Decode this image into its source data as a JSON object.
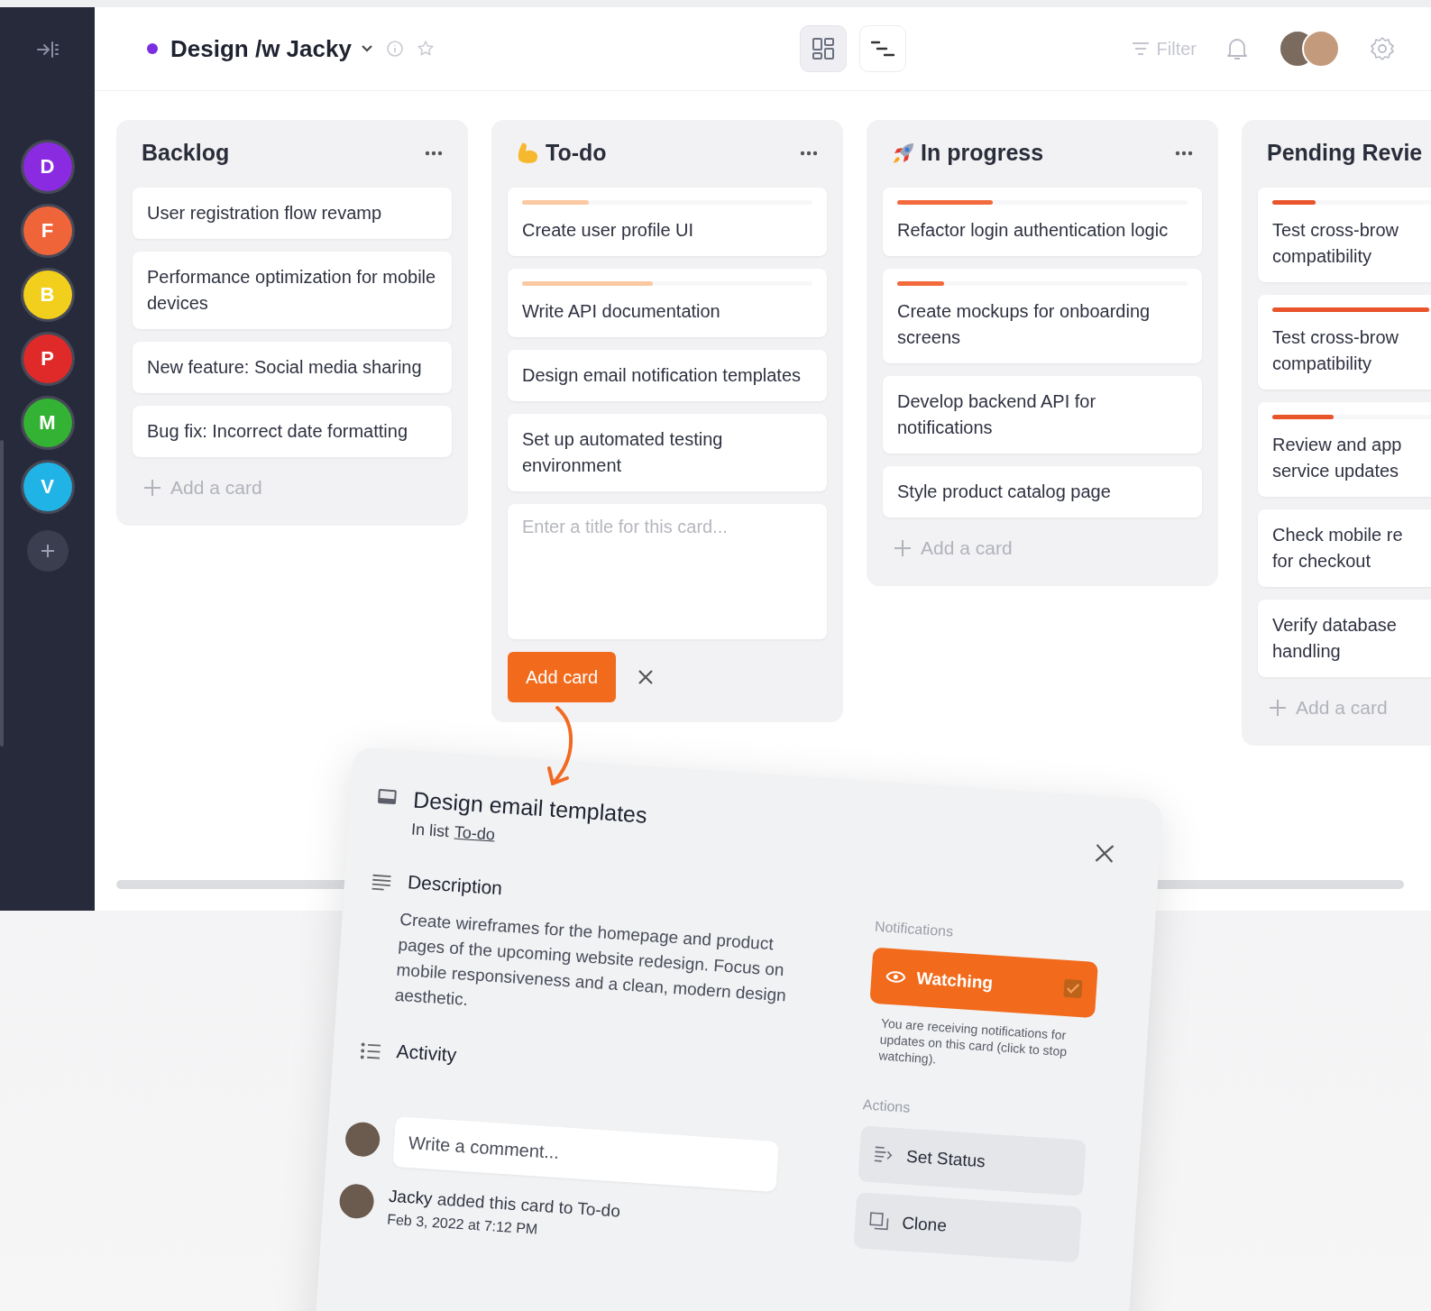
{
  "sidebar": {
    "workspaces": [
      {
        "initial": "D",
        "color": "#8a2be2"
      },
      {
        "initial": "F",
        "color": "#f0643a"
      },
      {
        "initial": "B",
        "color": "#f2cf1d"
      },
      {
        "initial": "P",
        "color": "#e02a2a"
      },
      {
        "initial": "M",
        "color": "#34b233"
      },
      {
        "initial": "V",
        "color": "#1fb3e6"
      }
    ]
  },
  "header": {
    "board_title": "Design /w Jacky",
    "views": [
      {
        "kind": "board",
        "selected": true
      },
      {
        "kind": "timeline",
        "selected": false
      }
    ],
    "filter": "Filter"
  },
  "columns": [
    {
      "title": "Backlog",
      "cards": [
        {
          "text": "User registration flow revamp"
        },
        {
          "text": "Performance optimization for mobile devices"
        },
        {
          "text": "New feature: Social media sharing"
        },
        {
          "text": "Bug fix: Incorrect date formatting"
        }
      ],
      "add": "Add a card"
    },
    {
      "title": "To-do",
      "cards": [
        {
          "text": "Create user profile UI",
          "bar": {
            "level": 0.23,
            "color": "#fbc8a2"
          }
        },
        {
          "text": "Write API documentation",
          "bar": {
            "level": 0.45,
            "color": "#fbc8a2"
          }
        },
        {
          "text": "Design email notification templates"
        },
        {
          "text": "Set up automated testing environment"
        }
      ],
      "composer": {
        "placeholder": "Enter a title for this card...",
        "button": "Add card"
      }
    },
    {
      "title": "In progress",
      "cards": [
        {
          "text": "Refactor login authentication logic",
          "bar": {
            "level": 0.33,
            "color": "#f26a3c"
          }
        },
        {
          "text": "Create mockups for onboarding screens",
          "bar": {
            "level": 0.16,
            "color": "#f26a3c"
          }
        },
        {
          "text": "Develop backend API for notifications"
        },
        {
          "text": "Style product catalog page"
        }
      ],
      "add": "Add a card"
    },
    {
      "title": "Pending Revie",
      "cards": [
        {
          "text": "Test cross-brow\ncompatibility",
          "bar": {
            "level": 0.15,
            "color": "#e9542a"
          }
        },
        {
          "text": "Test cross-brow\ncompatibility",
          "bar": {
            "level": 0.54,
            "color": "#e9542a"
          }
        },
        {
          "text": "Review and app\nservice updates",
          "bar": {
            "level": 0.21,
            "color": "#e9542a"
          }
        },
        {
          "text": "Check mobile re\nfor checkout"
        },
        {
          "text": "Verify database\nhandling"
        }
      ],
      "add": "Add a card"
    }
  ],
  "card_modal": {
    "title": "Design email templates",
    "list_prefix": "In list",
    "list_link": "To-do",
    "description_heading": "Description",
    "description": "Create wireframes for the homepage and product pages of the upcoming website redesign. Focus on mobile responsiveness and a clean, modern design aesthetic.",
    "activity_heading": "Activity",
    "comment_placeholder": "Write a comment...",
    "activity": [
      {
        "author": "Jacky",
        "action": "added this card to To-do",
        "time": "Feb 3, 2022 at 7:12 PM"
      }
    ],
    "notifications_label": "Notifications",
    "watch": {
      "label": "Watching",
      "checked": true
    },
    "watch_note": "You are receiving notifications for updates on this card (click to stop watching).",
    "actions_label": "Actions",
    "actions": [
      {
        "kind": "status",
        "label": "Set Status"
      },
      {
        "kind": "clone",
        "label": "Clone"
      }
    ]
  }
}
